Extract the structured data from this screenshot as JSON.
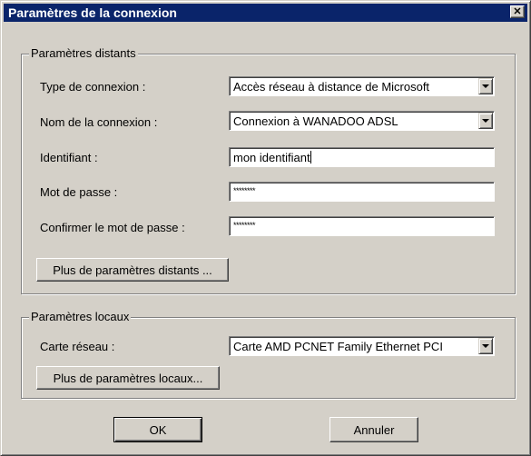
{
  "window": {
    "title": "Paramètres de la connexion",
    "close_glyph": "✕"
  },
  "remote": {
    "group_label": "Paramètres distants",
    "connection_type": {
      "label": "Type de connexion :",
      "value": "Accès réseau à distance de Microsoft"
    },
    "connection_name": {
      "label": "Nom de la connexion :",
      "value": "Connexion à WANADOO ADSL"
    },
    "identifier": {
      "label": "Identifiant :",
      "value": "mon identifiant"
    },
    "password": {
      "label": "Mot de passe :",
      "value": "********"
    },
    "confirm_password": {
      "label": "Confirmer le mot de passe :",
      "value": "********"
    },
    "more_button": "Plus de paramètres distants ..."
  },
  "local": {
    "group_label": "Paramètres locaux",
    "network_card": {
      "label": "Carte réseau :",
      "value": "Carte AMD PCNET Family Ethernet PCI"
    },
    "more_button": "Plus de paramètres locaux..."
  },
  "buttons": {
    "ok": "OK",
    "cancel": "Annuler"
  }
}
